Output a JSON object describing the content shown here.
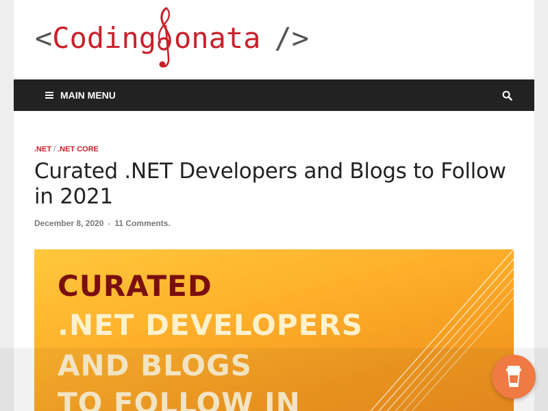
{
  "header": {
    "logo_open": "<",
    "logo_coding": "Coding",
    "logo_onata": "onata",
    "logo_close": "/>"
  },
  "nav": {
    "menu_label": "MAIN MENU",
    "search_icon": "search-icon"
  },
  "post": {
    "categories": [
      ".NET",
      ".NET CORE"
    ],
    "category_separator": "/",
    "title": "Curated .NET Developers and Blogs to Follow in 2021",
    "date": "December 8, 2020",
    "meta_separator": "-",
    "comments": "11 Comments."
  },
  "hero": {
    "line1": "CURATED",
    "line2": ".NET DEVELOPERS",
    "line3": "AND BLOGS",
    "line4": "TO FOLLOW IN"
  },
  "widgets": {
    "coffee_icon": "coffee-cup-icon"
  },
  "colors": {
    "brand_red": "#c8202a",
    "nav_bg": "#222222",
    "hero_orange": "#ffb22c",
    "coffee_orange": "#f07a44"
  }
}
